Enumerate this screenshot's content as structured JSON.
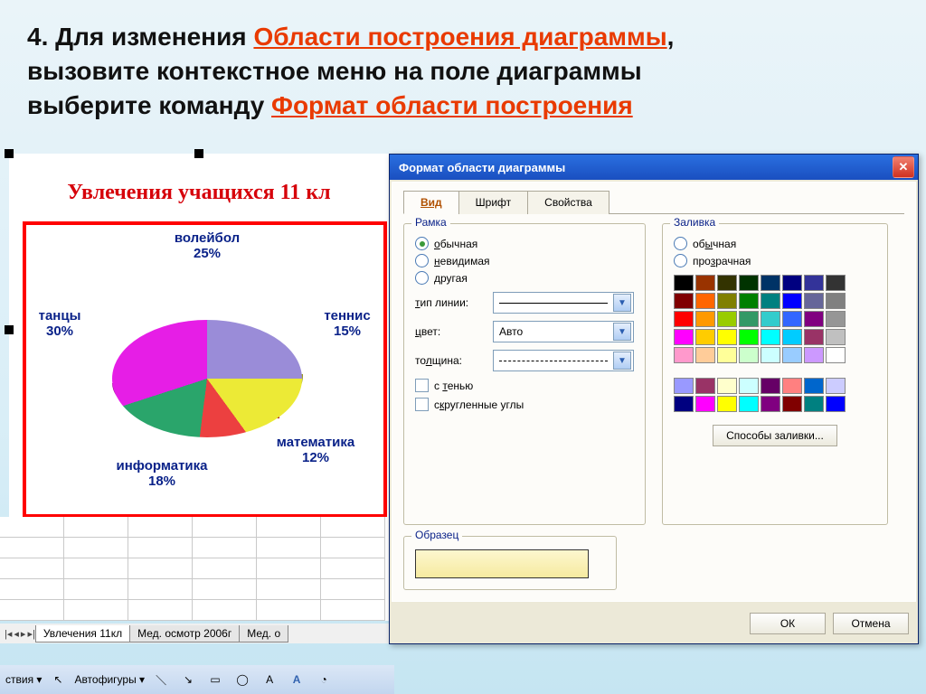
{
  "slide": {
    "line1_a": "4. Для изменения ",
    "line1_b": "Области построения диаграммы",
    "line1_c": ",",
    "line2": " вызовите контекстное меню на поле диаграммы",
    "line3_a": "выберите команду ",
    "line3_b": "Формат области построения"
  },
  "chart_data": {
    "type": "pie",
    "title": "Увлечения  учащихся  11 кл",
    "categories": [
      "волейбол",
      "теннис",
      "математика",
      "информатика",
      "танцы"
    ],
    "values": [
      25,
      15,
      12,
      18,
      30
    ],
    "series": [
      {
        "name": "волейбол",
        "value": 25,
        "color": "#9a8cd8"
      },
      {
        "name": "теннис",
        "value": 15,
        "color": "#ecea36"
      },
      {
        "name": "математика",
        "value": 12,
        "color": "#ec4040"
      },
      {
        "name": "информатика",
        "value": 18,
        "color": "#2aa56b"
      },
      {
        "name": "танцы",
        "value": 30,
        "color": "#e61ee6"
      }
    ],
    "labels": {
      "volleyball": "волейбол\n25%",
      "tennis": "теннис\n15%",
      "math": "математика\n12%",
      "informatics": "информатика\n18%",
      "dance": "танцы\n30%"
    }
  },
  "sheet_tabs": {
    "t1": "Увлечения 11кл",
    "t2": "Мед. осмотр 2006г",
    "t3": "Мед. о"
  },
  "bottom_toolbar": {
    "autoshapes": "Автофигуры"
  },
  "dialog": {
    "title": "Формат области диаграммы",
    "tabs": {
      "view": "Вид",
      "font": "Шрифт",
      "props": "Свойства"
    },
    "frame": {
      "legend": "Рамка",
      "r_normal": "обычная",
      "r_invisible": "невидимая",
      "r_custom": "другая",
      "l_linetype": "тип линии:",
      "l_color": "цвет:",
      "v_color": "Авто",
      "l_weight": "толщина:",
      "c_shadow": "с тенью",
      "c_rounded": "скругленные углы"
    },
    "fill": {
      "legend": "Заливка",
      "r_normal": "обычная",
      "r_transparent": "прозрачная",
      "btn_effects": "Способы заливки..."
    },
    "sample_legend": "Образец",
    "ok": "ОК",
    "cancel": "Отмена"
  },
  "palette": [
    "#000000",
    "#993300",
    "#333300",
    "#003300",
    "#003366",
    "#000080",
    "#333399",
    "#333333",
    "#800000",
    "#ff6600",
    "#808000",
    "#008000",
    "#008080",
    "#0000ff",
    "#666699",
    "#808080",
    "#ff0000",
    "#ff9900",
    "#99cc00",
    "#339966",
    "#33cccc",
    "#3366ff",
    "#800080",
    "#969696",
    "#ff00ff",
    "#ffcc00",
    "#ffff00",
    "#00ff00",
    "#00ffff",
    "#00ccff",
    "#993366",
    "#c0c0c0",
    "#ff99cc",
    "#ffcc99",
    "#ffff99",
    "#ccffcc",
    "#ccffff",
    "#99ccff",
    "#cc99ff",
    "#ffffff"
  ],
  "palette2": [
    "#9999ff",
    "#993366",
    "#ffffcc",
    "#ccffff",
    "#660066",
    "#ff8080",
    "#0066cc",
    "#ccccff",
    "#000080",
    "#ff00ff",
    "#ffff00",
    "#00ffff",
    "#800080",
    "#800000",
    "#008080",
    "#0000ff"
  ]
}
